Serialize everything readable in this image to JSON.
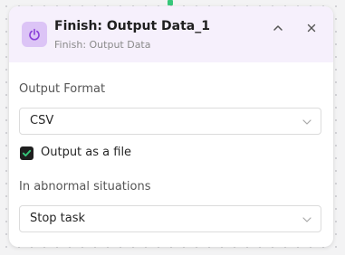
{
  "node": {
    "title": "Finish: Output Data_1",
    "subtitle": "Finish: Output Data",
    "icon": "power-icon",
    "icon_color": "#8a3fd9",
    "header_bg": "#f6f0fc"
  },
  "output_format": {
    "label": "Output Format",
    "value": "CSV"
  },
  "output_as_file": {
    "label": "Output as a file",
    "checked": true,
    "check_color": "#36c77a"
  },
  "abnormal": {
    "label": "In abnormal situations",
    "value": "Stop task"
  }
}
